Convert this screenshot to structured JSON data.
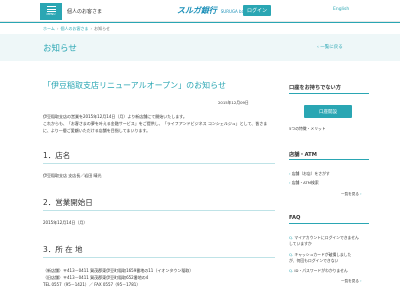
{
  "header": {
    "menu_label": "MENU",
    "links": [
      "個人のお客さま",
      "法人のお客さま"
    ],
    "logo_jp": "スルガ銀行",
    "logo_en": "SURUGA bank",
    "login_label": "ログイン",
    "english_label": "English"
  },
  "breadcrumb": [
    "ホーム",
    "個人のお客さま",
    "お知らせ"
  ],
  "page": {
    "title": "お知らせ",
    "back_label": "一覧に戻る"
  },
  "article": {
    "title": "「伊豆稲取支店リニューアルオープン」のお知らせ",
    "date": "2015年12月09日",
    "body": [
      "伊豆稲取支店の営業を2015年12月14日（月）より新店舗にて開始いたします。",
      "これからも、「お客さまの夢を叶える金融サービス」をご提供し、「ライフアンドビジネス コンシェルジュ」として、皆さまに、より一層ご愛顧いただける店舗を目指してまいります。"
    ],
    "sections": [
      {
        "heading": "1．店名",
        "lines": [
          "伊豆稲取支店 支店長／岩田 晴光"
        ]
      },
      {
        "heading": "2．営業開始日",
        "lines": [
          "2015年12月14日（月）"
        ]
      },
      {
        "heading": "3．所 在 地",
        "lines": [
          "（新店舗）〒413－0411 賀茂郡東伊豆町稲取1659番地の11（イオンタウン稲取）",
          "（旧店舗）〒413－0411 賀茂郡東伊豆町稲取652番地の4",
          "TEL  0557（95－1421）／ FAX  0557（95－1781）"
        ]
      }
    ]
  },
  "sidebar": {
    "account_title": "口座をお持ちでない方",
    "open_label": "口座開設",
    "account_link": "5つの特徴・メリット",
    "store_title": "店舗・ATM",
    "store_links": [
      "店舗（お店）をさがす",
      "店舗・ATM検索"
    ],
    "more_label": "一覧を見る",
    "faq_title": "FAQ",
    "faq_items": [
      "マイアカウントにログインできません",
      "キャッシュカードが破損しました",
      "ID・パスワードがわかりません"
    ],
    "faq_extra": [
      "が、何回もログインできない",
      "していますか"
    ]
  }
}
